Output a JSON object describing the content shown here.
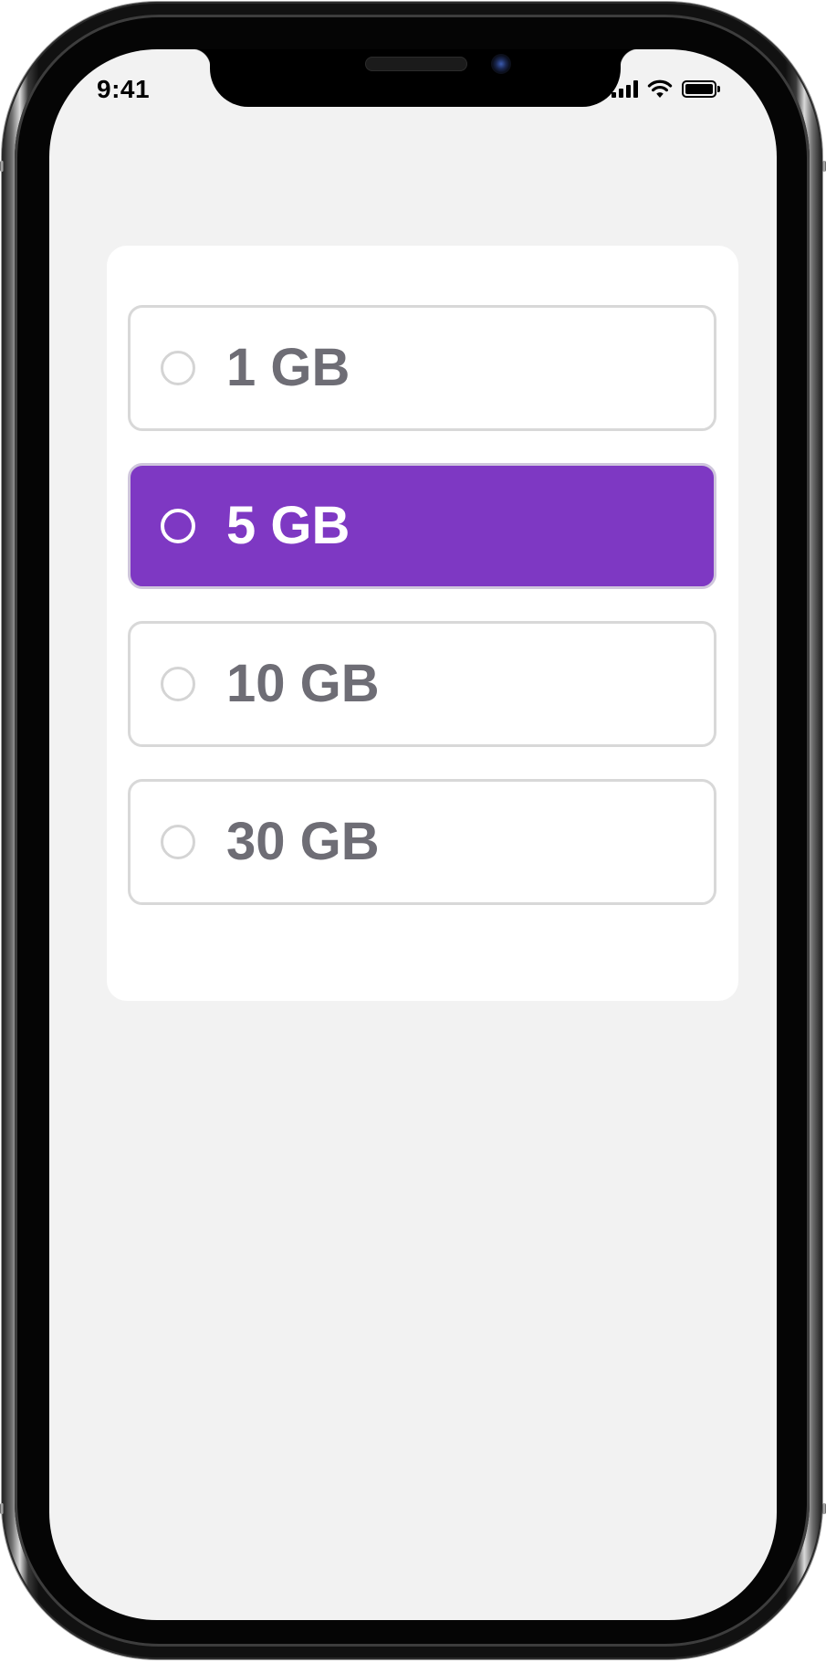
{
  "status_bar": {
    "time": "9:41",
    "icons": [
      "cellular-signal-icon",
      "wifi-icon",
      "battery-icon"
    ]
  },
  "storage_options": {
    "selected_index": 1,
    "items": [
      {
        "label": "1 GB",
        "selected": false
      },
      {
        "label": "5 GB",
        "selected": true
      },
      {
        "label": "10 GB",
        "selected": false
      },
      {
        "label": "30 GB",
        "selected": false
      }
    ]
  },
  "colors": {
    "accent": "#7e38c3",
    "screen_background": "#f2f2f2",
    "card_background": "#ffffff",
    "option_border": "#d8d8d8",
    "option_text": "#6e6d75"
  }
}
